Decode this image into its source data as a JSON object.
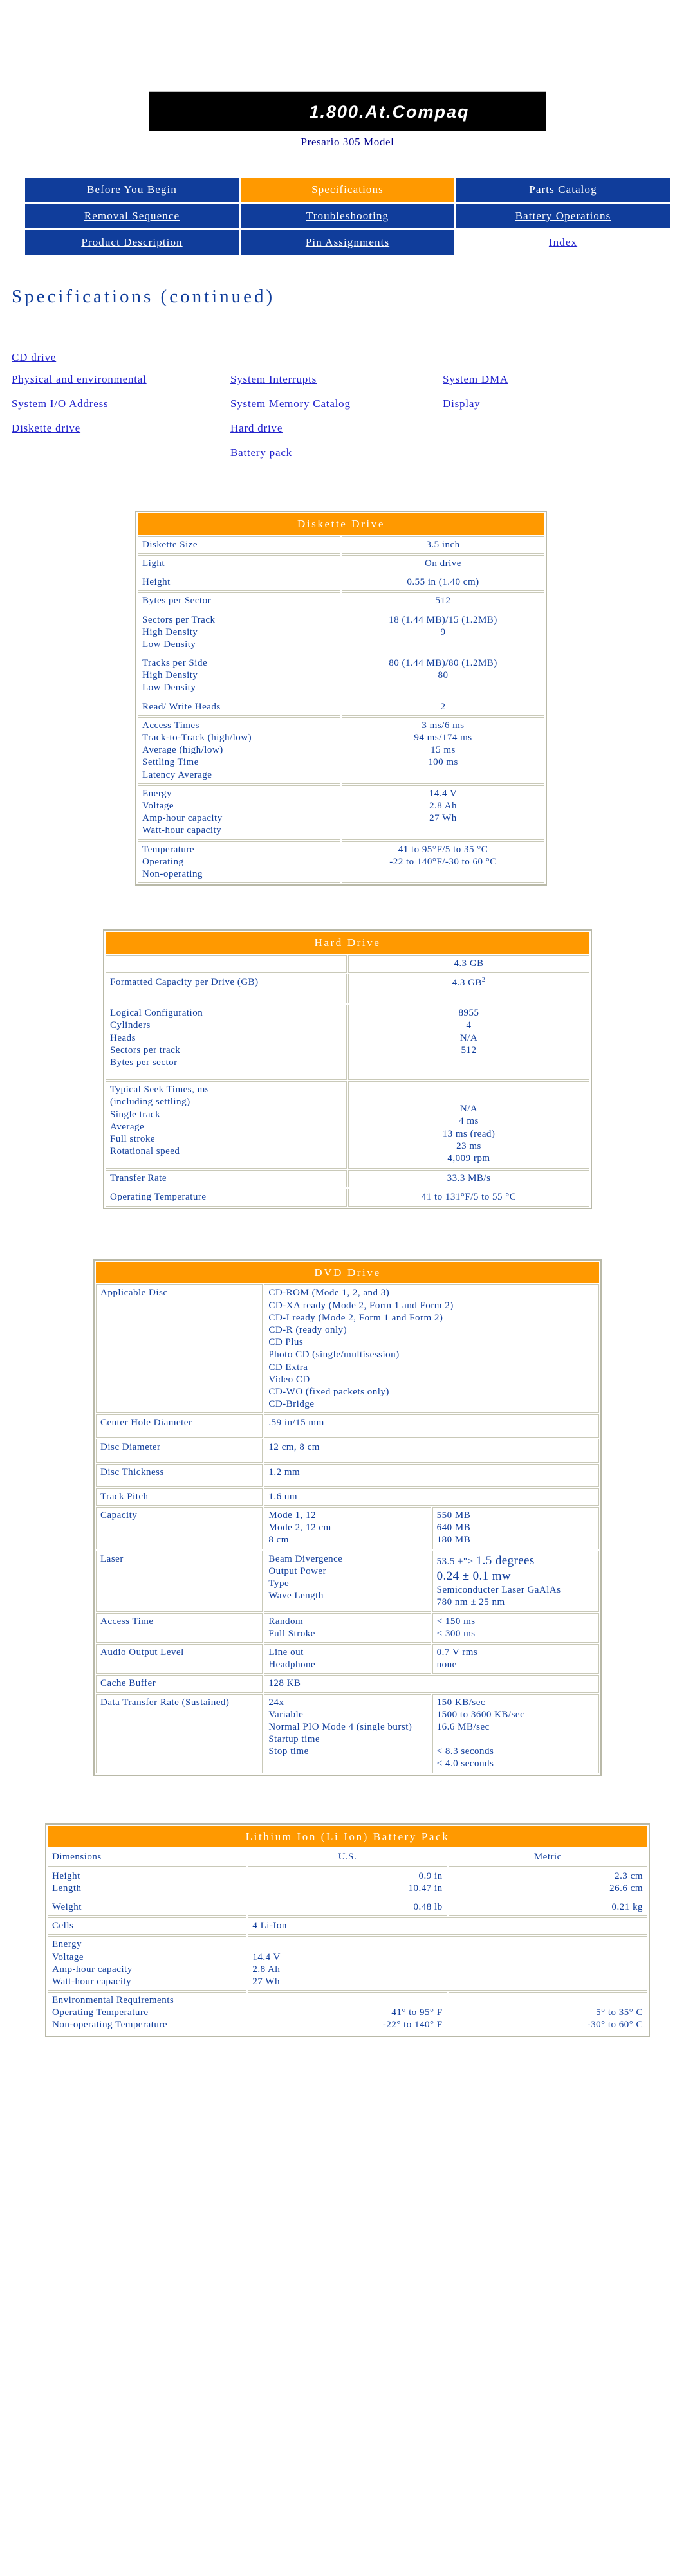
{
  "header": {
    "logo_text": "1.800.At.Compaq",
    "model_line": "Presario 305 Model"
  },
  "nav": {
    "items": [
      {
        "label": "Before You Begin",
        "state": "normal"
      },
      {
        "label": "Specifications",
        "state": "active"
      },
      {
        "label": "Parts Catalog",
        "state": "normal"
      },
      {
        "label": "Removal Sequence",
        "state": "normal"
      },
      {
        "label": "Troubleshooting",
        "state": "normal"
      },
      {
        "label": "Battery Operations",
        "state": "normal"
      },
      {
        "label": "Product Description",
        "state": "normal"
      },
      {
        "label": "Pin Assignments",
        "state": "normal"
      },
      {
        "label": "Index",
        "state": "blank"
      }
    ]
  },
  "page_title": "Specifications (continued)",
  "index_links": {
    "top": "CD drive",
    "col1": [
      "Physical and environmental",
      "System I/O Address",
      "Diskette drive"
    ],
    "col2": [
      "System Interrupts",
      "System Memory Catalog",
      "Hard drive",
      "Battery pack"
    ],
    "col3": [
      "System DMA",
      "Display"
    ]
  },
  "diskette": {
    "title": "Diskette Drive",
    "rows": [
      {
        "key": "Diskette Size",
        "val": "3.5 inch"
      },
      {
        "key": "Light",
        "val": "On drive"
      },
      {
        "key": "Height",
        "val": "0.55 in (1.40 cm)"
      },
      {
        "key": "Bytes per Sector",
        "val": "512"
      },
      {
        "key": "Sectors per Track\nHigh Density\nLow Density",
        "val": "18 (1.44 MB)/15 (1.2MB)\n9"
      },
      {
        "key": "Tracks per Side\nHigh Density\nLow Density",
        "val": "80 (1.44 MB)/80 (1.2MB)\n80"
      },
      {
        "key": "Read/ Write Heads",
        "val": "2"
      },
      {
        "key": "Access Times\nTrack-to-Track (high/low)\nAverage (high/low)\nSettling Time\nLatency Average",
        "val": "3 ms/6 ms\n94 ms/174 ms\n15 ms\n100 ms"
      },
      {
        "key": "Energy\nVoltage\nAmp-hour capacity\nWatt-hour capacity",
        "val": "14.4 V\n2.8 Ah\n27 Wh"
      },
      {
        "key": "Temperature\nOperating\nNon-operating",
        "val": "41 to 95°F/5 to 35 °C\n-22 to 140°F/-30 to 60 °C"
      }
    ]
  },
  "hard_drive": {
    "title": "Hard Drive",
    "capacity_header": "4.3 GB",
    "rows": [
      {
        "key": "Formatted Capacity per Drive (GB)",
        "val": "4.3 GB",
        "sup": "2"
      },
      {
        "key": "Logical Configuration\nCylinders\nHeads\nSectors per track\nBytes per sector",
        "val": "8955\n4\nN/A\n512"
      },
      {
        "key": "Typical Seek Times, ms\n(including settling)\nSingle track\nAverage\nFull stroke\nRotational speed",
        "val": "N/A\n4 ms\n13 ms (read)\n23 ms\n4,009 rpm"
      },
      {
        "key": "Transfer Rate",
        "val": "33.3 MB/s"
      },
      {
        "key": "Operating Temperature",
        "val": "41 to 131°F/5 to 55 °C"
      }
    ]
  },
  "dvd": {
    "title": "DVD Drive",
    "applicable_disc_label": "Applicable Disc",
    "applicable_disc_values": [
      "CD-ROM (Mode 1, 2, and 3)",
      "CD-XA ready (Mode 2, Form 1 and Form 2)",
      "CD-I ready (Mode 2, Form 1 and Form 2)",
      "CD-R (ready only)",
      "CD Plus",
      "Photo CD (single/multisession)",
      "CD Extra",
      "Video CD",
      "CD-WO (fixed packets only)",
      "CD-Bridge"
    ],
    "simple_rows": [
      {
        "key": "Center Hole Diameter",
        "val": ".59 in/15 mm"
      },
      {
        "key": "Disc Diameter",
        "val": "12 cm,  8 cm"
      },
      {
        "key": "Disc Thickness",
        "val": "1.2 mm"
      },
      {
        "key": "Track Pitch",
        "val": "1.6 um"
      }
    ],
    "capacity": {
      "key": "Capacity",
      "mid": "Mode 1, 12\nMode 2, 12 cm\n8 cm",
      "val": "550 MB\n640 MB\n180 MB"
    },
    "laser": {
      "key": "Laser",
      "mid": "Beam Divergence\nOutput Power\nType\nWave Length",
      "line1_small": "53.5 ±\">",
      "line1_big": "1.5 degrees",
      "line2_big": "0.24 ± 0.1 mw",
      "line3": "Semiconducter Laser GaAlAs",
      "line4": "780 nm ± 25 nm"
    },
    "access_time": {
      "key": "Access Time",
      "mid": "Random\nFull Stroke",
      "val": "< 150 ms\n< 300 ms"
    },
    "audio": {
      "key": "Audio Output Level",
      "mid": "Line out\nHeadphone",
      "val": "0.7 V rms\nnone"
    },
    "cache": {
      "key": "Cache Buffer",
      "val": "128 KB"
    },
    "data_rate": {
      "key": "Data Transfer Rate (Sustained)",
      "mid": "24x\nVariable\nNormal PIO Mode 4 (single burst)\nStartup time\nStop time",
      "val": "150 KB/sec\n1500 to 3600 KB/sec\n16.6 MB/sec\n\n< 8.3 seconds\n< 4.0 seconds"
    }
  },
  "battery": {
    "title": "Lithium Ion (Li Ion) Battery Pack",
    "col_headers": [
      "Dimensions",
      "U.S.",
      "Metric"
    ],
    "rows": [
      {
        "key": "Height\nLength",
        "c2": "0.9 in\n10.47 in",
        "c3": "2.3 cm\n26.6 cm",
        "align": "right"
      },
      {
        "key": "Weight",
        "c2": "0.48 lb",
        "c3": "0.21 kg",
        "align": "right"
      },
      {
        "key": "Cells",
        "c2": "4 Li-Ion",
        "c3": "",
        "span": true,
        "align": "left"
      },
      {
        "key": "Energy\nVoltage\nAmp-hour capacity\nWatt-hour capacity",
        "c2": "\n14.4 V\n2.8 Ah\n27 Wh",
        "c3": "",
        "span": true,
        "align": "left"
      },
      {
        "key": "Environmental Requirements\nOperating Temperature\nNon-operating Temperature",
        "c2": "\n41° to 95° F\n-22° to 140° F",
        "c3": "\n5° to 35° C\n-30° to 60° C",
        "align": "right"
      }
    ]
  }
}
